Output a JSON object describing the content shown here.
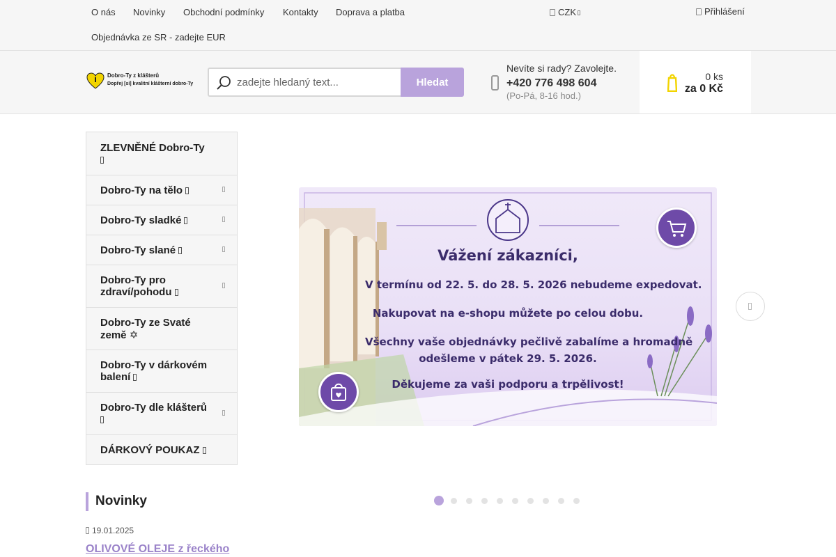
{
  "topbar": {
    "links": [
      "O nás",
      "Novinky",
      "Obchodní podmínky",
      "Kontakty",
      "Doprava a platba",
      "Objednávka ze SR - zadejte EUR"
    ],
    "currency": "CZK",
    "login": "Přihlášení"
  },
  "header": {
    "logo_line1": "Dobro-Ty z klášterů",
    "logo_line2": "Dopřej [si] kvalitní klášterní dobro-Ty",
    "search_placeholder": "zadejte hledaný text...",
    "search_button": "Hledat",
    "contact_question": "Nevíte si rady? Zavolejte.",
    "phone": "+420 776 498 604",
    "hours": "(Po-Pá, 8-16 hod.)",
    "cart_qty": "0 ks",
    "cart_total": "za 0 Kč"
  },
  "categories": [
    {
      "label": "ZLEVNĚNÉ Dobro-Ty",
      "submenu": false
    },
    {
      "label": "Dobro-Ty na tělo",
      "submenu": true
    },
    {
      "label": "Dobro-Ty sladké",
      "submenu": true
    },
    {
      "label": "Dobro-Ty slané",
      "submenu": true
    },
    {
      "label": "Dobro-Ty pro zdraví/pohodu",
      "submenu": true
    },
    {
      "label": "Dobro-Ty ze Svaté země ✡",
      "submenu": false
    },
    {
      "label": "Dobro-Ty v dárkovém balení",
      "submenu": false
    },
    {
      "label": "Dobro-Ty dle klášterů",
      "submenu": true
    },
    {
      "label": "DÁRKOVÝ POUKAZ",
      "submenu": false
    }
  ],
  "banner": {
    "title": "Vážení zákazníci,",
    "line1": "V termínu od 22. 5. do 28. 5. 2026 nebudeme expedovat.",
    "line2": "Nakupovat na e-shopu můžete po celou dobu.",
    "line3": "Všechny vaše objednávky pečlivě zabalíme a hromadně",
    "line4": "odešleme v pátek 29. 5. 2026.",
    "line5": "Děkujeme za vaši podporu a trpělivost!",
    "slide_count": 10,
    "active_slide": 1
  },
  "news": {
    "heading": "Novinky",
    "date": "19.01.2025",
    "link": "OLIVOVÉ OLEJE z řeckého"
  },
  "colors": {
    "accent": "#b9a3dc",
    "accent_dark": "#6e4aa8",
    "banner_text": "#3b2c6b",
    "logo_yellow": "#f2d400"
  }
}
